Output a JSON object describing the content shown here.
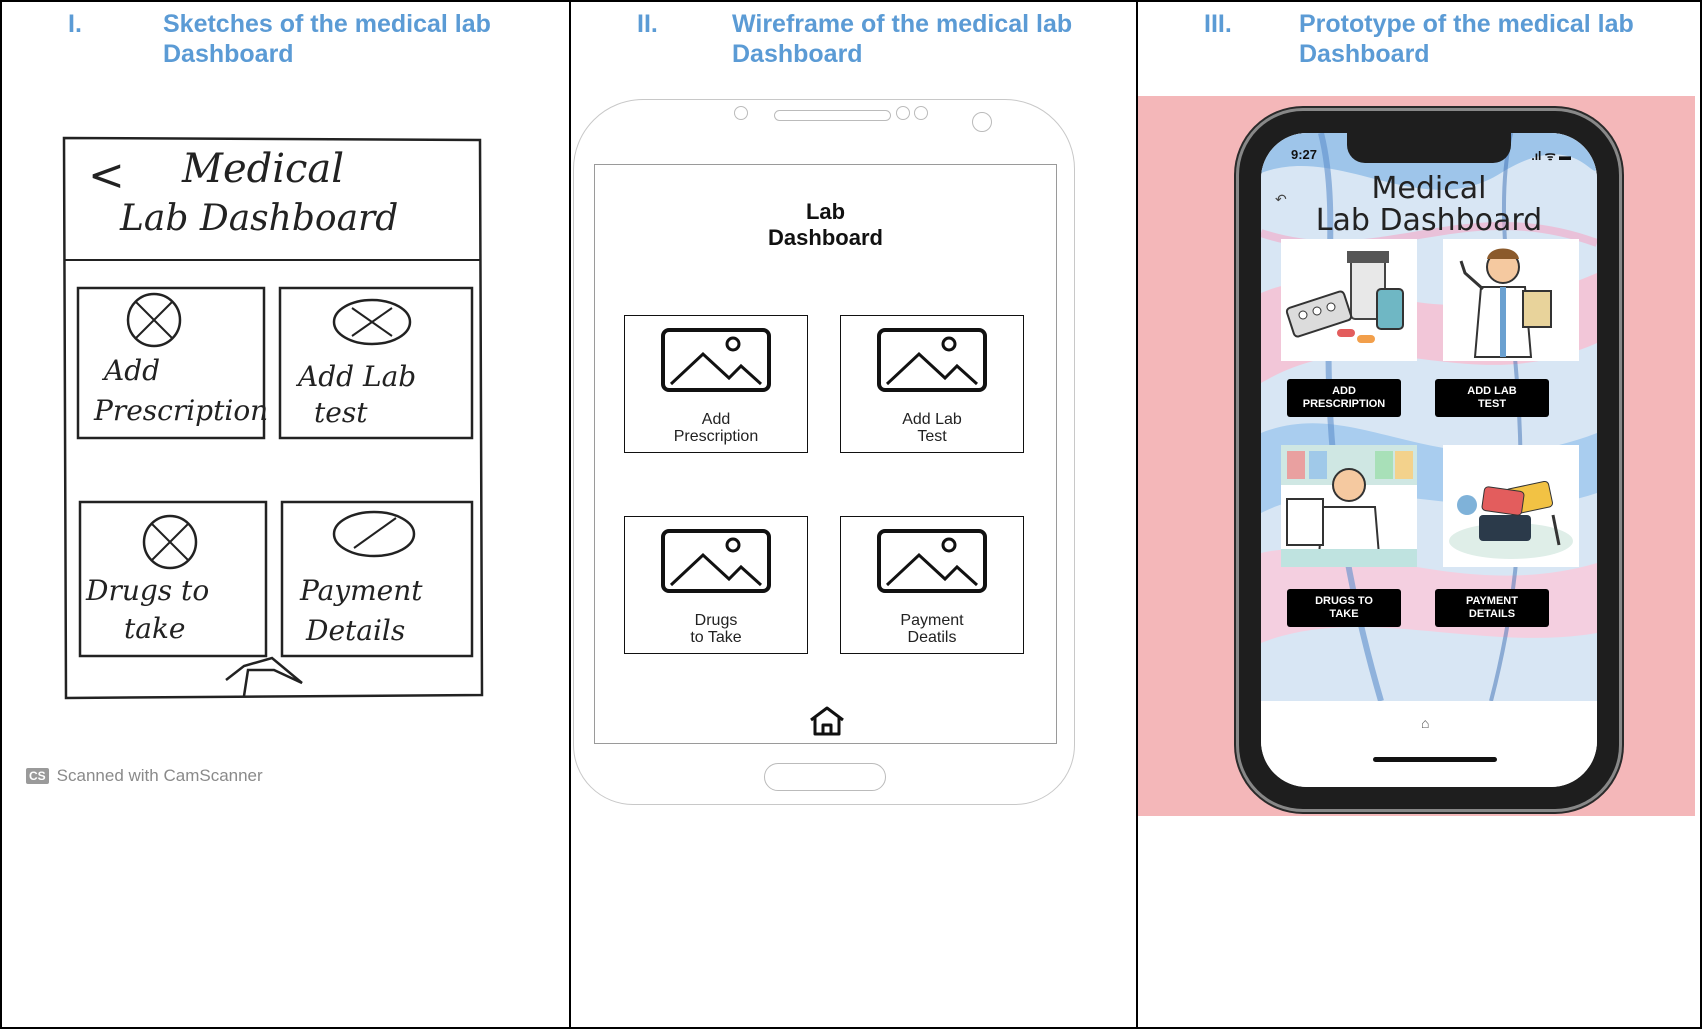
{
  "columns": [
    {
      "num": "I.",
      "title": "Sketches of the medical lab Dashboard"
    },
    {
      "num": "II.",
      "title": "Wireframe of the medical lab Dashboard"
    },
    {
      "num": "III.",
      "title": "Prototype of the medical lab Dashboard"
    }
  ],
  "sketch": {
    "title_line1": "Medical",
    "title_line2": "Lab Dashboard",
    "back_glyph": "<",
    "cards": [
      {
        "line1": "Add",
        "line2": "Prescription"
      },
      {
        "line1": "Add Lab",
        "line2": "test"
      },
      {
        "line1": "Drugs to",
        "line2": "take"
      },
      {
        "line1": "Payment",
        "line2": "Details"
      }
    ],
    "scanner_logo": "CS",
    "scanner_text": "Scanned with CamScanner"
  },
  "wireframe": {
    "title": "Lab\nDashboard",
    "cards": [
      {
        "label": "Add\nPrescription"
      },
      {
        "label": "Add Lab\nTest"
      },
      {
        "label": "Drugs\nto Take"
      },
      {
        "label": "Payment\nDeatils"
      }
    ]
  },
  "prototype": {
    "time": "9:27",
    "status_icons": ".ıl ᯤ ▬",
    "back_glyph": "↶",
    "title": "Medical\nLab Dashboard",
    "buttons": [
      "ADD\nPRESCRIPTION",
      "ADD LAB\nTEST",
      "DRUGS TO\nTAKE",
      "PAYMENT\nDETAILS"
    ],
    "home_glyph": "⌂",
    "colors": {
      "background": "#f4b7b9",
      "header": "#5b9bd5"
    }
  }
}
